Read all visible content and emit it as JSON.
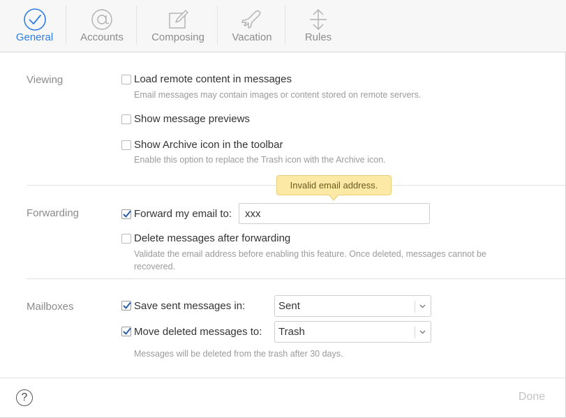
{
  "tabs": [
    {
      "label": "General",
      "icon": "checkmark-circle-icon",
      "active": true
    },
    {
      "label": "Accounts",
      "icon": "at-sign-icon",
      "active": false
    },
    {
      "label": "Composing",
      "icon": "compose-icon",
      "active": false
    },
    {
      "label": "Vacation",
      "icon": "airplane-icon",
      "active": false
    },
    {
      "label": "Rules",
      "icon": "rules-arrows-icon",
      "active": false
    }
  ],
  "viewing": {
    "label": "Viewing",
    "load_remote": {
      "label": "Load remote content in messages",
      "checked": false,
      "hint": "Email messages may contain images or content stored on remote servers."
    },
    "previews": {
      "label": "Show message previews",
      "checked": false
    },
    "archive_icon": {
      "label": "Show Archive icon in the toolbar",
      "checked": false,
      "hint": "Enable this option to replace the Trash icon with the Archive icon."
    }
  },
  "forwarding": {
    "label": "Forwarding",
    "forward": {
      "label": "Forward my email to:",
      "checked": true,
      "value": "xxx"
    },
    "tooltip": "Invalid email address.",
    "delete_after": {
      "label": "Delete messages after forwarding",
      "checked": false,
      "hint_line1": "Validate the email address before enabling this feature. Once deleted, messages cannot be",
      "hint_line2": "recovered."
    }
  },
  "mailboxes": {
    "label": "Mailboxes",
    "save_sent": {
      "label": "Save sent messages in:",
      "checked": true,
      "value": "Sent"
    },
    "move_deleted": {
      "label": "Move deleted messages to:",
      "checked": true,
      "value": "Trash"
    },
    "hint": "Messages will be deleted from the trash after 30 days."
  },
  "footer": {
    "help": "?",
    "done": "Done"
  },
  "colors": {
    "accent": "#2f7de1",
    "tooltip_bg": "#fbe9a5",
    "disabled_text": "#c3c3c3"
  }
}
